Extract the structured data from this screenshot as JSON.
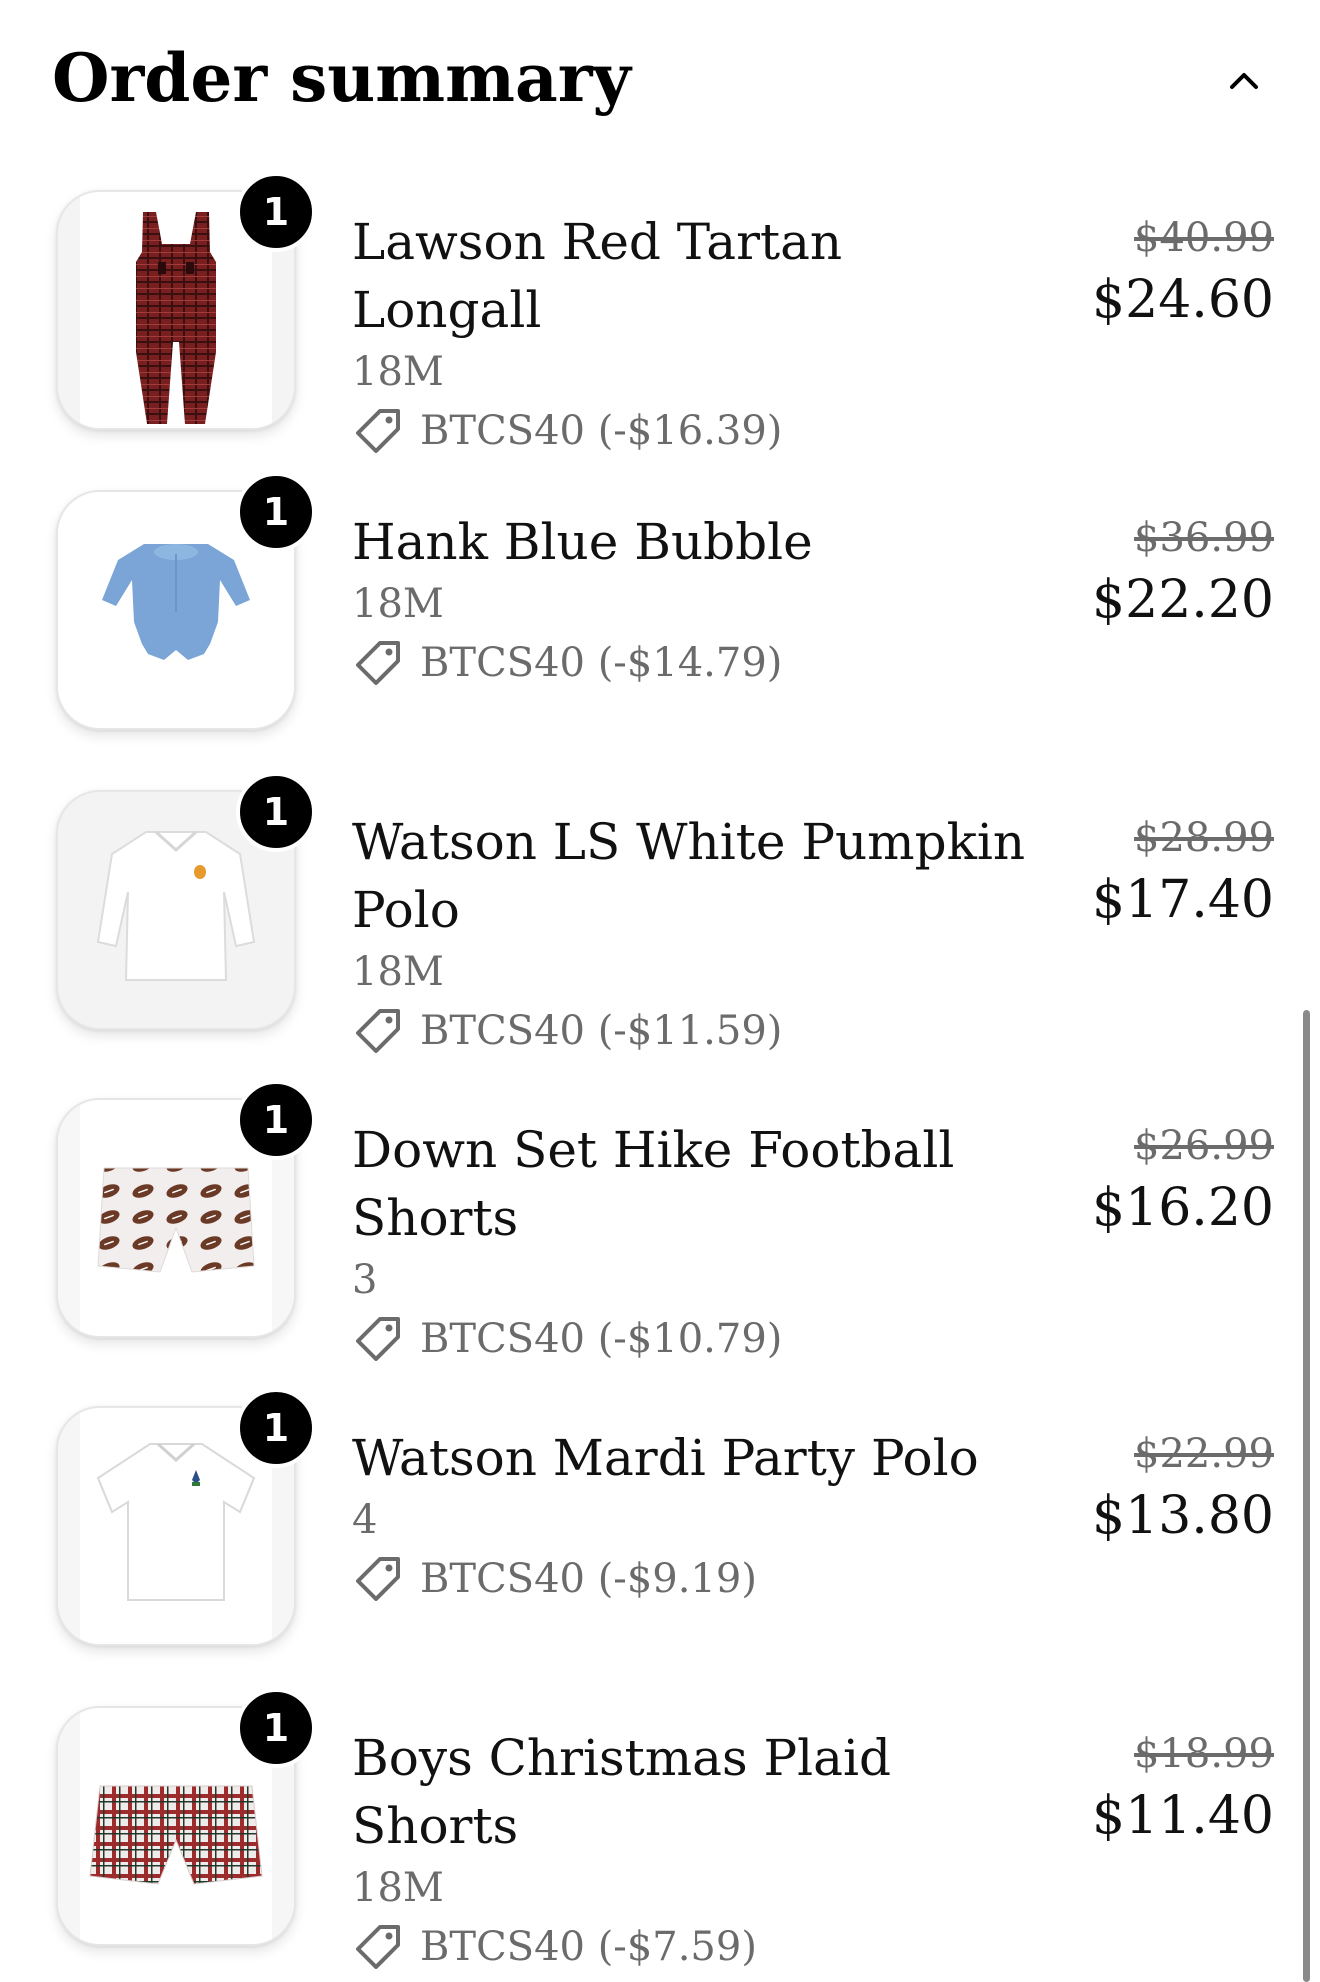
{
  "header": {
    "title": "Order summary",
    "toggle_icon": "chevron-up-icon"
  },
  "items": [
    {
      "quantity": "1",
      "name": "Lawson Red Tartan Longall",
      "variant": "18M",
      "discount": "BTCS40 (-$16.39)",
      "original_price": "$40.99",
      "final_price": "$24.60",
      "image": "red-tartan-longall"
    },
    {
      "quantity": "1",
      "name": "Hank Blue Bubble",
      "variant": "18M",
      "discount": "BTCS40 (-$14.79)",
      "original_price": "$36.99",
      "final_price": "$22.20",
      "image": "blue-bubble"
    },
    {
      "quantity": "1",
      "name": "Watson LS White Pumpkin Polo",
      "variant": "18M",
      "discount": "BTCS40 (-$11.59)",
      "original_price": "$28.99",
      "final_price": "$17.40",
      "image": "white-pumpkin-polo"
    },
    {
      "quantity": "1",
      "name": "Down Set Hike Football Shorts",
      "variant": "3",
      "discount": "BTCS40 (-$10.79)",
      "original_price": "$26.99",
      "final_price": "$16.20",
      "image": "football-shorts"
    },
    {
      "quantity": "1",
      "name": "Watson Mardi Party Polo",
      "variant": "4",
      "discount": "BTCS40 (-$9.19)",
      "original_price": "$22.99",
      "final_price": "$13.80",
      "image": "mardi-polo"
    },
    {
      "quantity": "1",
      "name": "Boys Christmas Plaid Shorts",
      "variant": "18M",
      "discount": "BTCS40 (-$7.59)",
      "original_price": "$18.99",
      "final_price": "$11.40",
      "image": "christmas-plaid-shorts"
    }
  ],
  "colors": {
    "text": "#111111",
    "muted": "#6b6b6b",
    "badge": "#000000"
  }
}
